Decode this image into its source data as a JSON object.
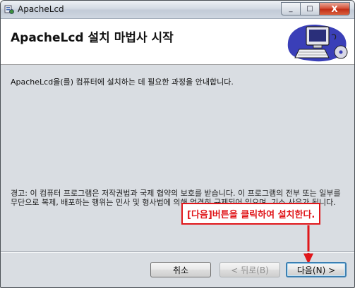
{
  "window": {
    "title": "ApacheLcd"
  },
  "title_buttons": {
    "minimize": "_",
    "maximize": "□",
    "close": "X"
  },
  "header": {
    "title": "ApacheLcd 설치 마법사 시작"
  },
  "body": {
    "intro": "ApacheLcd을(를) 컴퓨터에 설치하는 데 필요한 과정을 안내합니다.",
    "warning": "경고: 이 컴퓨터 프로그램은 저작권법과 국제 협약의 보호를 받습니다. 이 프로그램의 전부 또는 일부를 무단으로 복제, 배포하는 행위는 민사 및 형사법에 의해 엄격히 규제되어 있으며, 기소 사유가 됩니다."
  },
  "annotation": {
    "text": "[다음]버튼을 클릭하여 설치한다.",
    "color": "#e0161a"
  },
  "buttons": {
    "cancel": "취소",
    "back": "< 뒤로(B)",
    "next": "다음(N) >"
  }
}
